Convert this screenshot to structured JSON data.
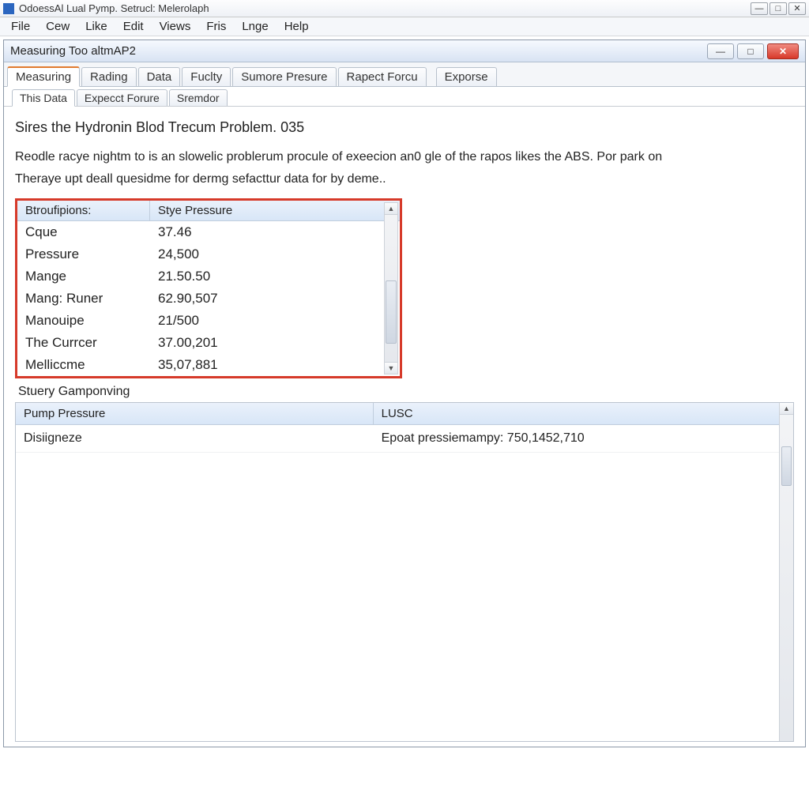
{
  "app": {
    "title": "OdoessAl Lual Pymp. Setrucl: Melerolaph"
  },
  "menubar": [
    "File",
    "Cew",
    "Like",
    "Edit",
    "Views",
    "Fris",
    "Lnge",
    "Help"
  ],
  "childwin": {
    "title": "Measuring Too altmAP2"
  },
  "tabs_primary": [
    "Measuring",
    "Rading",
    "Data",
    "Fuclty",
    "Sumore Presure",
    "Rapect Forcu",
    "Exporse"
  ],
  "tabs_primary_active": 0,
  "tabs_secondary": [
    "This Data",
    "Expecct Forure",
    "Sremdor"
  ],
  "tabs_secondary_active": 0,
  "main": {
    "heading": "Sires the Hydronin Blod Trecum Problem. 035",
    "para1": "Reodle racye nightm to is an slowelic problerum procule of exeecion an0 gle of the rapos likes the ABS. Por park on",
    "para2": "Theraye upt deall quesidme for dermg sefacttur data for by deme.."
  },
  "databox": {
    "col1": "Btroufipions:",
    "col2": "Stye Pressure",
    "rows": [
      {
        "label": "Cque",
        "value": "37.46"
      },
      {
        "label": "Pressure",
        "value": "24,500"
      },
      {
        "label": "Mange",
        "value": "21.50.50"
      },
      {
        "label": "Mang: Runer",
        "value": "62.90,507"
      },
      {
        "label": "Manouipe",
        "value": "21/500"
      },
      {
        "label": "The Currcer",
        "value": "37.00,201"
      },
      {
        "label": "Melliccme",
        "value": "35,07,881"
      }
    ]
  },
  "lower": {
    "section_label": "Stuery Gamponving",
    "col1": "Pump Pressure",
    "col2": "LUSC",
    "rows": [
      {
        "c1": "Disiigneze",
        "c2": "Epoat pressiemampy: 750,1452,710"
      }
    ]
  }
}
